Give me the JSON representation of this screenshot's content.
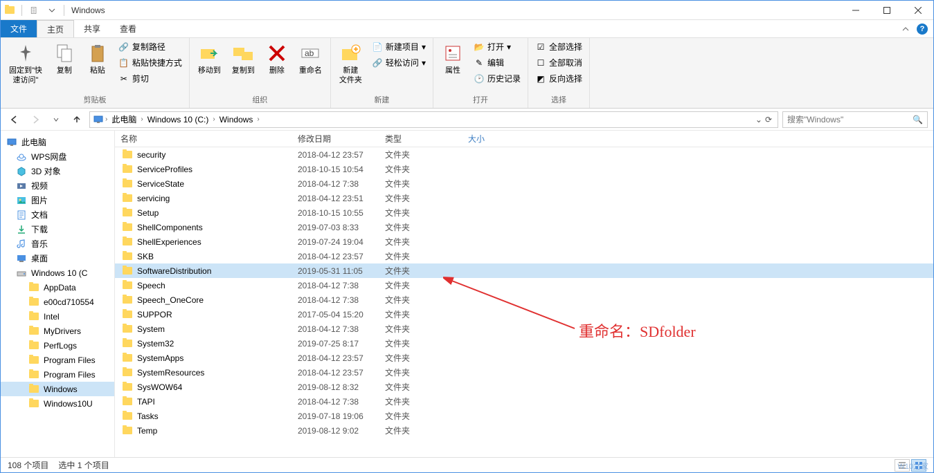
{
  "window": {
    "title": "Windows"
  },
  "tabs": {
    "file": "文件",
    "home": "主页",
    "share": "共享",
    "view": "查看"
  },
  "ribbon": {
    "clipboard": {
      "label": "剪贴板",
      "pin": "固定到\"快\n速访问\"",
      "copy": "复制",
      "paste": "粘贴",
      "copypath": "复制路径",
      "pasteshortcut": "粘贴快捷方式",
      "cut": "剪切"
    },
    "organize": {
      "label": "组织",
      "moveto": "移动到",
      "copyto": "复制到",
      "delete": "删除",
      "rename": "重命名"
    },
    "new": {
      "label": "新建",
      "newfolder": "新建\n文件夹",
      "newitem": "新建项目",
      "easyaccess": "轻松访问"
    },
    "open": {
      "label": "打开",
      "properties": "属性",
      "open": "打开",
      "edit": "编辑",
      "history": "历史记录"
    },
    "select": {
      "label": "选择",
      "selectall": "全部选择",
      "selectnone": "全部取消",
      "invert": "反向选择"
    }
  },
  "breadcrumb": [
    "此电脑",
    "Windows 10 (C:)",
    "Windows"
  ],
  "search_placeholder": "搜索\"Windows\"",
  "tree": [
    {
      "label": "此电脑",
      "level": 0,
      "icon": "pc"
    },
    {
      "label": "WPS网盘",
      "level": 1,
      "icon": "cloud"
    },
    {
      "label": "3D 对象",
      "level": 1,
      "icon": "3d"
    },
    {
      "label": "视频",
      "level": 1,
      "icon": "video"
    },
    {
      "label": "图片",
      "level": 1,
      "icon": "pic"
    },
    {
      "label": "文档",
      "level": 1,
      "icon": "doc"
    },
    {
      "label": "下载",
      "level": 1,
      "icon": "dl"
    },
    {
      "label": "音乐",
      "level": 1,
      "icon": "music"
    },
    {
      "label": "桌面",
      "level": 1,
      "icon": "desk"
    },
    {
      "label": "Windows 10 (C",
      "level": 1,
      "icon": "drive"
    },
    {
      "label": "AppData",
      "level": 2,
      "icon": "folder"
    },
    {
      "label": "e00cd710554",
      "level": 2,
      "icon": "folder"
    },
    {
      "label": "Intel",
      "level": 2,
      "icon": "folder"
    },
    {
      "label": "MyDrivers",
      "level": 2,
      "icon": "folder"
    },
    {
      "label": "PerfLogs",
      "level": 2,
      "icon": "folder"
    },
    {
      "label": "Program Files",
      "level": 2,
      "icon": "folder"
    },
    {
      "label": "Program Files",
      "level": 2,
      "icon": "folder"
    },
    {
      "label": "Windows",
      "level": 2,
      "icon": "folder",
      "selected": true
    },
    {
      "label": "Windows10U",
      "level": 2,
      "icon": "folder"
    }
  ],
  "columns": {
    "name": "名称",
    "date": "修改日期",
    "type": "类型",
    "size": "大小"
  },
  "files": [
    {
      "name": "security",
      "date": "2018-04-12 23:57",
      "type": "文件夹"
    },
    {
      "name": "ServiceProfiles",
      "date": "2018-10-15 10:54",
      "type": "文件夹"
    },
    {
      "name": "ServiceState",
      "date": "2018-04-12 7:38",
      "type": "文件夹"
    },
    {
      "name": "servicing",
      "date": "2018-04-12 23:51",
      "type": "文件夹"
    },
    {
      "name": "Setup",
      "date": "2018-10-15 10:55",
      "type": "文件夹"
    },
    {
      "name": "ShellComponents",
      "date": "2019-07-03 8:33",
      "type": "文件夹"
    },
    {
      "name": "ShellExperiences",
      "date": "2019-07-24 19:04",
      "type": "文件夹"
    },
    {
      "name": "SKB",
      "date": "2018-04-12 23:57",
      "type": "文件夹"
    },
    {
      "name": "SoftwareDistribution",
      "date": "2019-05-31 11:05",
      "type": "文件夹",
      "selected": true
    },
    {
      "name": "Speech",
      "date": "2018-04-12 7:38",
      "type": "文件夹"
    },
    {
      "name": "Speech_OneCore",
      "date": "2018-04-12 7:38",
      "type": "文件夹"
    },
    {
      "name": "SUPPOR",
      "date": "2017-05-04 15:20",
      "type": "文件夹"
    },
    {
      "name": "System",
      "date": "2018-04-12 7:38",
      "type": "文件夹"
    },
    {
      "name": "System32",
      "date": "2019-07-25 8:17",
      "type": "文件夹"
    },
    {
      "name": "SystemApps",
      "date": "2018-04-12 23:57",
      "type": "文件夹"
    },
    {
      "name": "SystemResources",
      "date": "2018-04-12 23:57",
      "type": "文件夹"
    },
    {
      "name": "SysWOW64",
      "date": "2019-08-12 8:32",
      "type": "文件夹"
    },
    {
      "name": "TAPI",
      "date": "2018-04-12 7:38",
      "type": "文件夹"
    },
    {
      "name": "Tasks",
      "date": "2019-07-18 19:06",
      "type": "文件夹"
    },
    {
      "name": "Temp",
      "date": "2019-08-12 9:02",
      "type": "文件夹"
    }
  ],
  "status": {
    "count": "108 个项目",
    "selected": "选中 1 个项目"
  },
  "annotation": "重命名：SDfolder",
  "watermark": "W10之家"
}
